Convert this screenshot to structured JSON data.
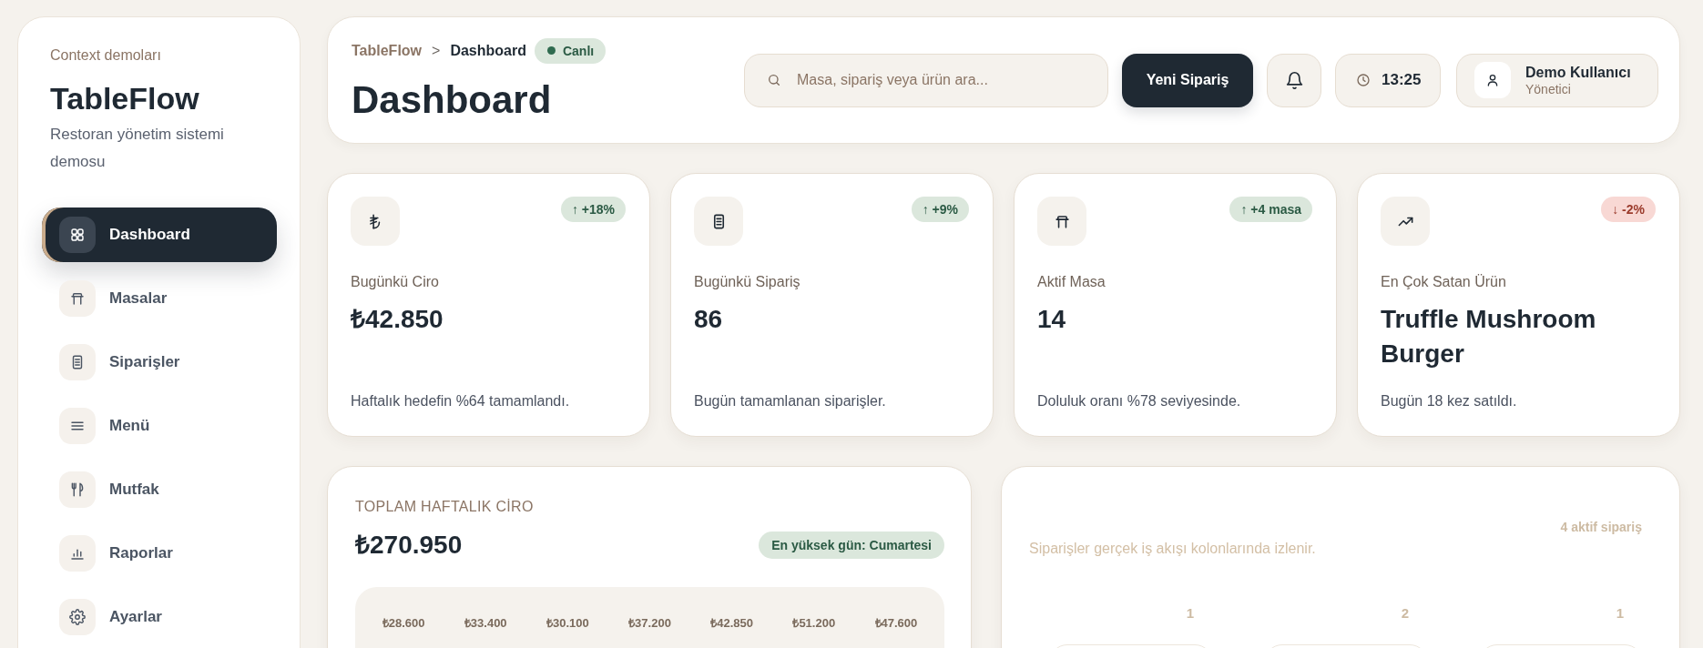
{
  "sidebar": {
    "eyebrow": "Context demoları",
    "title": "TableFlow",
    "subtitle": "Restoran yönetim sistemi demosu",
    "items": [
      {
        "label": "Dashboard",
        "selected": true
      },
      {
        "label": "Masalar",
        "selected": false
      },
      {
        "label": "Siparişler",
        "selected": false
      },
      {
        "label": "Menü",
        "selected": false
      },
      {
        "label": "Mutfak",
        "selected": false
      },
      {
        "label": "Raporlar",
        "selected": false
      },
      {
        "label": "Ayarlar",
        "selected": false
      }
    ]
  },
  "header": {
    "breadcrumb": [
      "TableFlow",
      "Dashboard"
    ],
    "breadcrumb_separator": ">",
    "status": "Canlı",
    "title": "Dashboard",
    "search": {
      "placeholder": "Masa, sipariş veya ürün ara..."
    },
    "primary_button": "Yeni Sipariş",
    "time": "13:25",
    "user": {
      "name": "Demo Kullanıcı",
      "role": "Yönetici"
    }
  },
  "stats": [
    {
      "label": "Bugünkü Ciro",
      "value": "₺42.850",
      "change": "↑ +18%",
      "negative": false,
      "note": "Haftalık hedefin %64 tamamlandı."
    },
    {
      "label": "Bugünkü Sipariş",
      "value": "86",
      "change": "↑ +9%",
      "negative": false,
      "note": "Bugün tamamlanan siparişler."
    },
    {
      "label": "Aktif Masa",
      "value": "14",
      "change": "↑ +4 masa",
      "negative": false,
      "note": "Doluluk oranı %78 seviyesinde."
    },
    {
      "label": "En Çok Satan Ürün",
      "value": "Truffle Mushroom Burger",
      "change": "↓ -2%",
      "negative": true,
      "note": "Bugün 18 kez satıldı."
    }
  ],
  "weekly_revenue": {
    "title": "TOPLAM HAFTALIK CİRO",
    "total": "₺270.950",
    "peak_badge": "En yüksek gün: Cumartesi",
    "day_values": [
      "₺28.600",
      "₺33.400",
      "₺30.100",
      "₺37.200",
      "₺42.850",
      "₺51.200",
      "₺47.600"
    ]
  },
  "orders_board": {
    "subtitle": "Siparişler gerçek iş akışı kolonlarında izlenir.",
    "active_count": "4 aktif sipariş",
    "columns": [
      {
        "count": "1"
      },
      {
        "count": "2"
      },
      {
        "count": "1"
      }
    ]
  }
}
